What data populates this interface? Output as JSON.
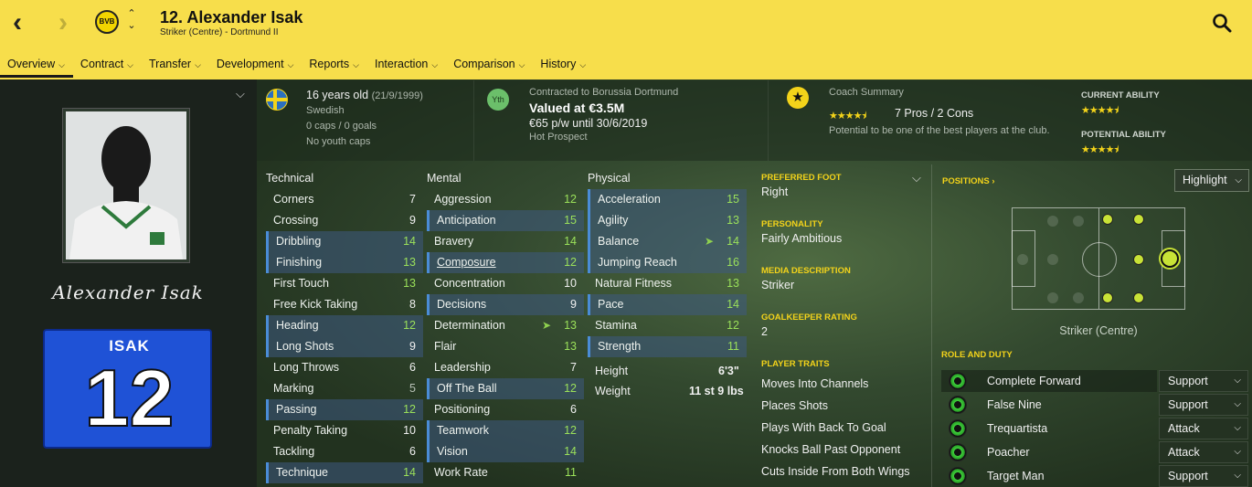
{
  "header": {
    "title": "12. Alexander Isak",
    "subtitle": "Striker (Centre) - Dortmund II",
    "club_badge_text": "BVB"
  },
  "menu": [
    {
      "label": "Overview"
    },
    {
      "label": "Contract"
    },
    {
      "label": "Transfer"
    },
    {
      "label": "Development"
    },
    {
      "label": "Reports"
    },
    {
      "label": "Interaction"
    },
    {
      "label": "Comparison"
    },
    {
      "label": "History"
    }
  ],
  "profile": {
    "signature": "Alexander Isak",
    "shirt_name": "ISAK",
    "shirt_number": "12"
  },
  "info": {
    "age": "16 years old",
    "dob": "(21/9/1999)",
    "nationality": "Swedish",
    "caps": "0 caps / 0 goals",
    "youth_caps": "No youth caps",
    "youth_badge": "Yth",
    "contract_club": "Contracted to Borussia Dortmund",
    "value": "Valued at €3.5M",
    "wage": "€65 p/w until 30/6/2019",
    "status": "Hot Prospect",
    "coach_caption": "Coach Summary",
    "coach_pros_cons": "7 Pros / 2 Cons",
    "coach_potential": "Potential to be one of the best players at the club.",
    "current_ability_label": "CURRENT ABILITY",
    "potential_ability_label": "POTENTIAL ABILITY",
    "coach_stars": 4.5,
    "current_ability_stars": 4.5,
    "potential_ability_stars": 4.5
  },
  "attributes": {
    "technical_title": "Technical",
    "mental_title": "Mental",
    "physical_title": "Physical",
    "technical": [
      {
        "name": "Corners",
        "value": "7"
      },
      {
        "name": "Crossing",
        "value": "9"
      },
      {
        "name": "Dribbling",
        "value": "14"
      },
      {
        "name": "Finishing",
        "value": "13"
      },
      {
        "name": "First Touch",
        "value": "13"
      },
      {
        "name": "Free Kick Taking",
        "value": "8"
      },
      {
        "name": "Heading",
        "value": "12"
      },
      {
        "name": "Long Shots",
        "value": "9"
      },
      {
        "name": "Long Throws",
        "value": "6"
      },
      {
        "name": "Marking",
        "value": "5"
      },
      {
        "name": "Passing",
        "value": "12"
      },
      {
        "name": "Penalty Taking",
        "value": "10"
      },
      {
        "name": "Tackling",
        "value": "6"
      },
      {
        "name": "Technique",
        "value": "14"
      }
    ],
    "mental": [
      {
        "name": "Aggression",
        "value": "12"
      },
      {
        "name": "Anticipation",
        "value": "15"
      },
      {
        "name": "Bravery",
        "value": "14"
      },
      {
        "name": "Composure",
        "value": "12"
      },
      {
        "name": "Concentration",
        "value": "10"
      },
      {
        "name": "Decisions",
        "value": "9"
      },
      {
        "name": "Determination",
        "value": "13"
      },
      {
        "name": "Flair",
        "value": "13"
      },
      {
        "name": "Leadership",
        "value": "7"
      },
      {
        "name": "Off The Ball",
        "value": "12"
      },
      {
        "name": "Positioning",
        "value": "6"
      },
      {
        "name": "Teamwork",
        "value": "12"
      },
      {
        "name": "Vision",
        "value": "14"
      },
      {
        "name": "Work Rate",
        "value": "11"
      }
    ],
    "physical": [
      {
        "name": "Acceleration",
        "value": "15"
      },
      {
        "name": "Agility",
        "value": "13"
      },
      {
        "name": "Balance",
        "value": "14"
      },
      {
        "name": "Jumping Reach",
        "value": "16"
      },
      {
        "name": "Natural Fitness",
        "value": "13"
      },
      {
        "name": "Pace",
        "value": "14"
      },
      {
        "name": "Stamina",
        "value": "12"
      },
      {
        "name": "Strength",
        "value": "11"
      }
    ],
    "height_label": "Height",
    "height_value": "6'3\"",
    "weight_label": "Weight",
    "weight_value": "11 st 9 lbs"
  },
  "details": {
    "preferred_foot_caption": "PREFERRED FOOT",
    "preferred_foot": "Right",
    "personality_caption": "PERSONALITY",
    "personality": "Fairly Ambitious",
    "media_caption": "MEDIA DESCRIPTION",
    "media": "Striker",
    "gk_caption": "GOALKEEPER RATING",
    "gk": "2",
    "traits_caption": "PLAYER TRAITS",
    "traits": [
      "Moves Into Channels",
      "Places Shots",
      "Plays With Back To Goal",
      "Knocks Ball Past Opponent",
      "Cuts Inside From Both Wings"
    ]
  },
  "positions": {
    "caption": "POSITIONS",
    "highlight": "Highlight",
    "position_label": "Striker (Centre)",
    "role_caption": "ROLE AND DUTY",
    "roles": [
      {
        "role": "Complete Forward",
        "duty": "Support"
      },
      {
        "role": "False Nine",
        "duty": "Support"
      },
      {
        "role": "Trequartista",
        "duty": "Attack"
      },
      {
        "role": "Poacher",
        "duty": "Attack"
      },
      {
        "role": "Target Man",
        "duty": "Support"
      }
    ]
  },
  "colors": {
    "header_bg": "#f7de4b",
    "accent_green": "#9be15a",
    "highlight_blue": "#4a8cd6",
    "star_gold": "#f3d31a"
  }
}
